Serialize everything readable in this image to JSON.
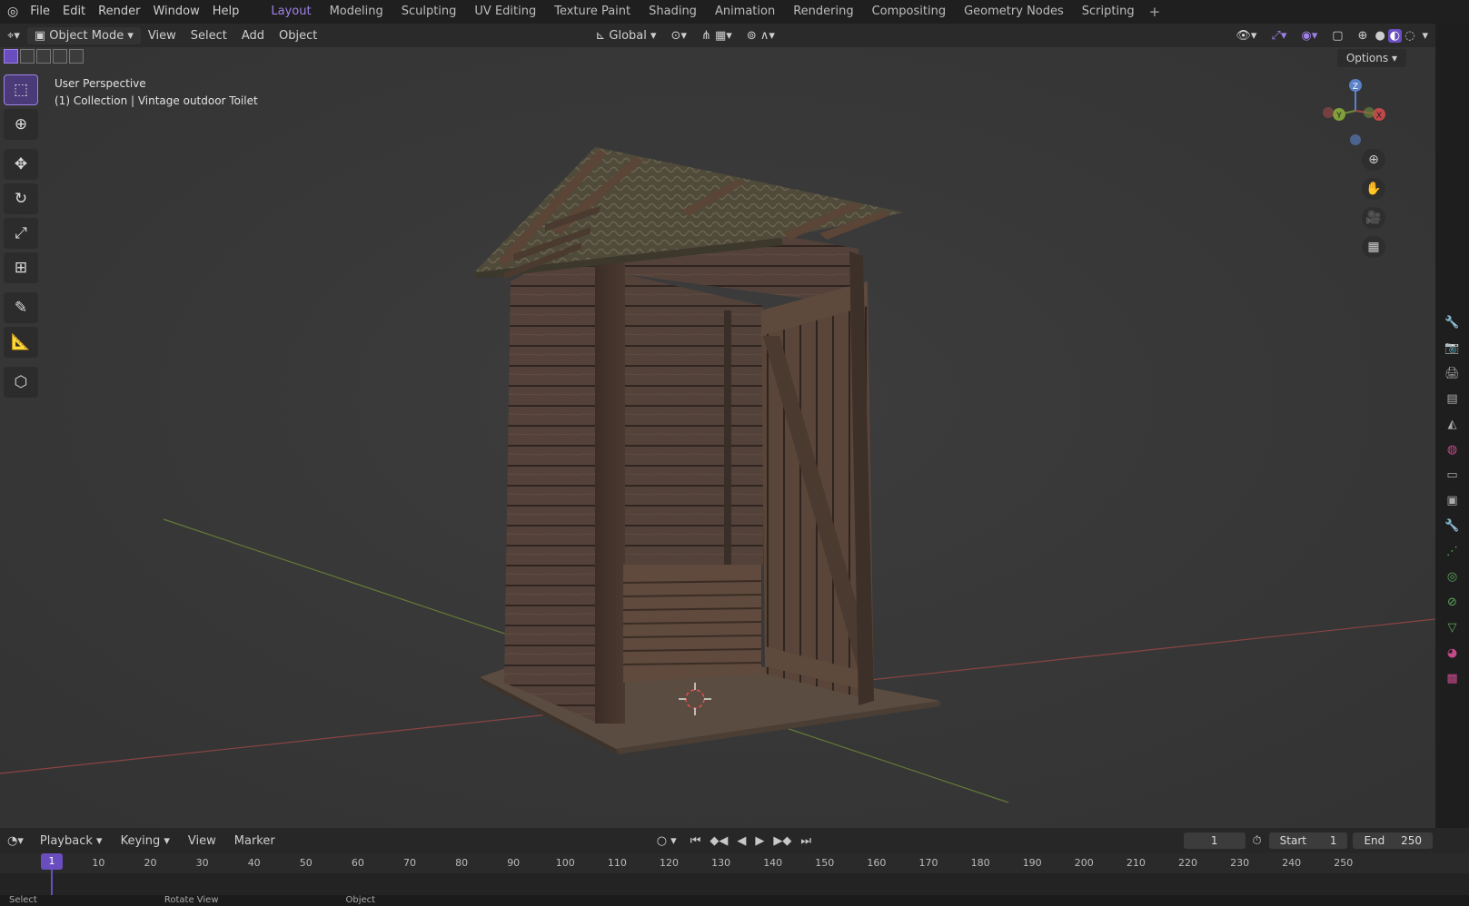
{
  "menu": [
    "File",
    "Edit",
    "Render",
    "Window",
    "Help"
  ],
  "workspaces": [
    "Layout",
    "Modeling",
    "Sculpting",
    "UV Editing",
    "Texture Paint",
    "Shading",
    "Animation",
    "Rendering",
    "Compositing",
    "Geometry Nodes",
    "Scripting"
  ],
  "active_workspace": "Layout",
  "header": {
    "mode": "Object Mode",
    "menus": [
      "View",
      "Select",
      "Add",
      "Object"
    ],
    "orientation": "Global"
  },
  "viewport": {
    "perspective": "User Perspective",
    "collection": "(1) Collection | Vintage outdoor Toilet",
    "options": "Options"
  },
  "gizmo": {
    "z": "Z",
    "y": "Y",
    "x": "X"
  },
  "timeline": {
    "menus": [
      "Playback",
      "Keying",
      "View",
      "Marker"
    ],
    "current_frame": "1",
    "start_label": "Start",
    "start": "1",
    "end_label": "End",
    "end": "250",
    "ticks": [
      "10",
      "20",
      "30",
      "40",
      "50",
      "60",
      "70",
      "80",
      "90",
      "100",
      "110",
      "120",
      "130",
      "140",
      "150",
      "160",
      "170",
      "180",
      "190",
      "200",
      "210",
      "220",
      "230",
      "240",
      "250"
    ],
    "playhead": "1"
  },
  "status": [
    "Select",
    "Rotate View",
    "Object"
  ],
  "colors": {
    "accent": "#9f82e6",
    "viewport_bg": "#393939",
    "axis_x": "#a04848",
    "axis_y": "#6f8a3a"
  }
}
